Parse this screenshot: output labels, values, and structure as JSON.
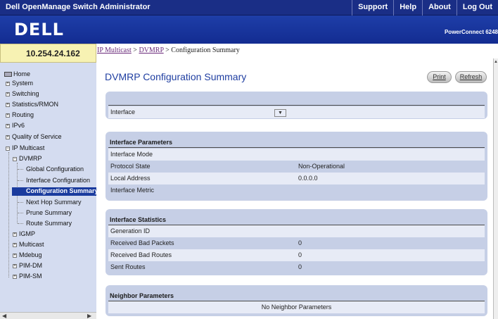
{
  "header": {
    "app_title": "Dell OpenManage Switch Administrator",
    "nav": [
      "Support",
      "Help",
      "About",
      "Log Out"
    ],
    "logo": "DELL",
    "model": "PowerConnect 6248"
  },
  "ip_address": "10.254.24.162",
  "breadcrumb": {
    "items": [
      "IP Multicast",
      "DVMRP"
    ],
    "separator": " > ",
    "current": "Configuration Summary"
  },
  "sidebar": {
    "home": "Home",
    "items": [
      {
        "label": "System",
        "expander": "+"
      },
      {
        "label": "Switching",
        "expander": "+"
      },
      {
        "label": "Statistics/RMON",
        "expander": "+"
      },
      {
        "label": "Routing",
        "expander": "+"
      },
      {
        "label": "IPv6",
        "expander": "+"
      },
      {
        "label": "Quality of Service",
        "expander": "+"
      },
      {
        "label": "IP Multicast",
        "expander": "−"
      }
    ],
    "dvmrp": {
      "label": "DVMRP",
      "expander": "−"
    },
    "dvmrp_children": [
      "Global Configuration",
      "Interface Configuration",
      "Configuration Summary",
      "Next Hop Summary",
      "Prune Summary",
      "Route Summary"
    ],
    "multicast_children": [
      {
        "label": "IGMP",
        "expander": "+"
      },
      {
        "label": "Multicast",
        "expander": "+"
      },
      {
        "label": "Mdebug",
        "expander": "+"
      },
      {
        "label": "PIM-DM",
        "expander": "+"
      },
      {
        "label": "PIM-SM",
        "expander": "+"
      }
    ],
    "selected": "Configuration Summary"
  },
  "page": {
    "title": "DVMRP Configuration Summary",
    "print_label": "Print",
    "refresh_label": "Refresh"
  },
  "interface_select": {
    "label": "Interface",
    "value": ""
  },
  "interface_parameters": {
    "heading": "Interface Parameters",
    "rows": [
      {
        "label": "Interface Mode",
        "value": ""
      },
      {
        "label": "Protocol State",
        "value": "Non-Operational"
      },
      {
        "label": "Local Address",
        "value": "0.0.0.0"
      },
      {
        "label": "Interface Metric",
        "value": ""
      }
    ]
  },
  "interface_statistics": {
    "heading": "Interface Statistics",
    "rows": [
      {
        "label": "Generation ID",
        "value": ""
      },
      {
        "label": "Received Bad Packets",
        "value": "0"
      },
      {
        "label": "Received Bad Routes",
        "value": "0"
      },
      {
        "label": "Sent Routes",
        "value": "0"
      }
    ]
  },
  "neighbor_parameters": {
    "heading": "Neighbor Parameters",
    "empty_text": "No Neighbor Parameters"
  }
}
